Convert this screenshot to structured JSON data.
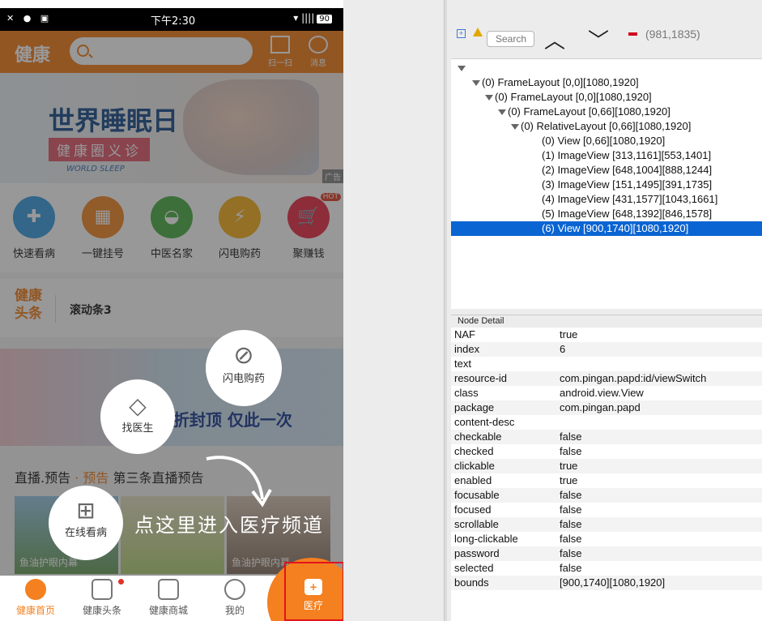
{
  "phone": {
    "status": {
      "left_icons": "✕ ● ▣",
      "time": "下午2:30",
      "signal": "▾ ||||",
      "battery": "90"
    },
    "header": {
      "logo": "健康",
      "search_placeholder": "",
      "scan_label": "扫一扫",
      "msg_label": "消息"
    },
    "banner": {
      "title": "世界睡眠日",
      "subtitle": "健康圈义诊",
      "tagline": "WORLD SLEEP",
      "ad": "广告"
    },
    "quick": [
      {
        "label": "快速看病",
        "color": "#3e9fe0",
        "glyph": "✚"
      },
      {
        "label": "一键挂号",
        "color": "#f28a2c",
        "glyph": "▦"
      },
      {
        "label": "中医名家",
        "color": "#4fb04b",
        "glyph": "◒"
      },
      {
        "label": "闪电购药",
        "color": "#f5b323",
        "glyph": "⚡"
      },
      {
        "label": "聚赚钱",
        "color": "#e8334a",
        "glyph": "🛒",
        "badge": "HOT"
      }
    ],
    "headline": {
      "label": "健康头条",
      "text": "滚动条3"
    },
    "ad2": {
      "text": "5折封顶 仅此一次"
    },
    "live": {
      "title": "直播.预告",
      "tag": "· 预告",
      "text": "第三条直播预告"
    },
    "thumbs": [
      "鱼油护眼内幕",
      "",
      "鱼油护眼内幕"
    ],
    "bubbles": {
      "drug": "闪电购药",
      "doctor": "找医生",
      "online": "在线看病"
    },
    "guide_text": "点这里进入医疗频道",
    "tabs": [
      "健康首页",
      "健康头条",
      "健康商城",
      "我的",
      "医疗"
    ]
  },
  "inspector": {
    "search_placeholder": "Search",
    "coords": "(981,1835)",
    "tree": [
      {
        "text": "(0) FrameLayout [0,0][1080,1920]",
        "depth": 0,
        "expander": true
      },
      {
        "text": "(0) FrameLayout [0,0][1080,1920]",
        "depth": 1,
        "expander": true
      },
      {
        "text": "(0) FrameLayout [0,66][1080,1920]",
        "depth": 2,
        "expander": true
      },
      {
        "text": "(0) RelativeLayout [0,66][1080,1920]",
        "depth": 3,
        "expander": true
      },
      {
        "text": "(0) View [0,66][1080,1920]",
        "depth": 4,
        "expander": false
      },
      {
        "text": "(1) ImageView [313,1161][553,1401]",
        "depth": 4,
        "expander": false
      },
      {
        "text": "(2) ImageView [648,1004][888,1244]",
        "depth": 4,
        "expander": false
      },
      {
        "text": "(3) ImageView [151,1495][391,1735]",
        "depth": 4,
        "expander": false
      },
      {
        "text": "(4) ImageView [431,1577][1043,1661]",
        "depth": 4,
        "expander": false
      },
      {
        "text": "(5) ImageView [648,1392][846,1578]",
        "depth": 4,
        "expander": false
      },
      {
        "text": "(6) View [900,1740][1080,1920]",
        "depth": 4,
        "expander": false,
        "selected": true
      }
    ],
    "detail_title": "Node Detail",
    "detail": [
      [
        "NAF",
        "true"
      ],
      [
        "index",
        "6"
      ],
      [
        "text",
        ""
      ],
      [
        "resource-id",
        "com.pingan.papd:id/viewSwitch"
      ],
      [
        "class",
        "android.view.View"
      ],
      [
        "package",
        "com.pingan.papd"
      ],
      [
        "content-desc",
        ""
      ],
      [
        "checkable",
        "false"
      ],
      [
        "checked",
        "false"
      ],
      [
        "clickable",
        "true"
      ],
      [
        "enabled",
        "true"
      ],
      [
        "focusable",
        "false"
      ],
      [
        "focused",
        "false"
      ],
      [
        "scrollable",
        "false"
      ],
      [
        "long-clickable",
        "false"
      ],
      [
        "password",
        "false"
      ],
      [
        "selected",
        "false"
      ],
      [
        "bounds",
        "[900,1740][1080,1920]"
      ]
    ]
  }
}
